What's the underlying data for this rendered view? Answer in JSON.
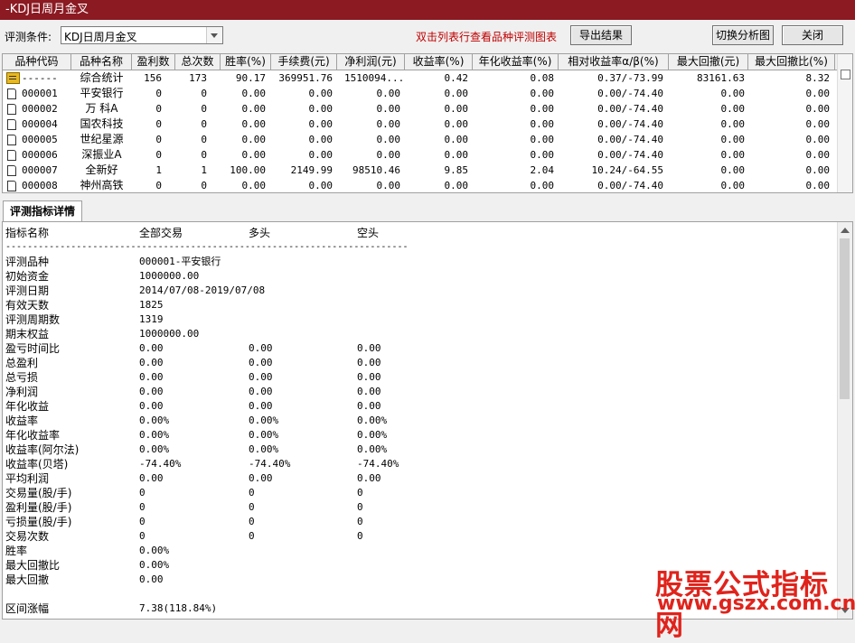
{
  "window": {
    "title": "-KDJ日周月金叉"
  },
  "toolbar": {
    "condition_label": "评测条件:",
    "condition_value": "KDJ日周月金叉",
    "hint": "双击列表行查看品种评测图表",
    "export_label": "导出结果",
    "switch_label": "切换分析图",
    "close_label": "关闭"
  },
  "table": {
    "columns": [
      "品种代码",
      "品种名称",
      "盈利数",
      "总次数",
      "胜率(%)",
      "手续费(元)",
      "净利润(元)",
      "收益率(%)",
      "年化收益率(%)",
      "相对收益率α/β(%)",
      "最大回撤(元)",
      "最大回撤比(%)"
    ],
    "summary": {
      "code": "------",
      "name": "综合统计",
      "wins": "156",
      "total": "173",
      "win_rate": "90.17",
      "fee": "369951.76",
      "net": "1510094...",
      "ret": "0.42",
      "annual": "0.08",
      "rel": "0.37/-73.99",
      "dd": "83161.63",
      "dd_ratio": "8.32"
    },
    "rows": [
      {
        "code": "000001",
        "name": "平安银行",
        "wins": "0",
        "total": "0",
        "win_rate": "0.00",
        "fee": "0.00",
        "net": "0.00",
        "ret": "0.00",
        "annual": "0.00",
        "rel": "0.00/-74.40",
        "dd": "0.00",
        "dd_ratio": "0.00"
      },
      {
        "code": "000002",
        "name": "万 科A",
        "wins": "0",
        "total": "0",
        "win_rate": "0.00",
        "fee": "0.00",
        "net": "0.00",
        "ret": "0.00",
        "annual": "0.00",
        "rel": "0.00/-74.40",
        "dd": "0.00",
        "dd_ratio": "0.00"
      },
      {
        "code": "000004",
        "name": "国农科技",
        "wins": "0",
        "total": "0",
        "win_rate": "0.00",
        "fee": "0.00",
        "net": "0.00",
        "ret": "0.00",
        "annual": "0.00",
        "rel": "0.00/-74.40",
        "dd": "0.00",
        "dd_ratio": "0.00"
      },
      {
        "code": "000005",
        "name": "世纪星源",
        "wins": "0",
        "total": "0",
        "win_rate": "0.00",
        "fee": "0.00",
        "net": "0.00",
        "ret": "0.00",
        "annual": "0.00",
        "rel": "0.00/-74.40",
        "dd": "0.00",
        "dd_ratio": "0.00"
      },
      {
        "code": "000006",
        "name": "深振业A",
        "wins": "0",
        "total": "0",
        "win_rate": "0.00",
        "fee": "0.00",
        "net": "0.00",
        "ret": "0.00",
        "annual": "0.00",
        "rel": "0.00/-74.40",
        "dd": "0.00",
        "dd_ratio": "0.00"
      },
      {
        "code": "000007",
        "name": "全新好",
        "wins": "1",
        "total": "1",
        "win_rate": "100.00",
        "fee": "2149.99",
        "net": "98510.46",
        "ret": "9.85",
        "annual": "2.04",
        "rel": "10.24/-64.55",
        "dd": "0.00",
        "dd_ratio": "0.00"
      },
      {
        "code": "000008",
        "name": "神州高铁",
        "wins": "0",
        "total": "0",
        "win_rate": "0.00",
        "fee": "0.00",
        "net": "0.00",
        "ret": "0.00",
        "annual": "0.00",
        "rel": "0.00/-74.40",
        "dd": "0.00",
        "dd_ratio": "0.00"
      }
    ]
  },
  "detail": {
    "tab_label": "评测指标详情",
    "headers": {
      "name": "指标名称",
      "all": "全部交易",
      "long": "多头",
      "short": "空头"
    },
    "separator": "--------------------------------------------------------------------------",
    "lines": [
      {
        "label": "评测品种",
        "all": "000001-平安银行",
        "long": "",
        "short": ""
      },
      {
        "label": "初始资金",
        "all": "1000000.00",
        "long": "",
        "short": ""
      },
      {
        "label": "评测日期",
        "all": "2014/07/08-2019/07/08",
        "long": "",
        "short": ""
      },
      {
        "label": "有效天数",
        "all": "1825",
        "long": "",
        "short": ""
      },
      {
        "label": "评测周期数",
        "all": "1319",
        "long": "",
        "short": ""
      },
      {
        "label": "期末权益",
        "all": "1000000.00",
        "long": "",
        "short": ""
      },
      {
        "label": "盈亏时间比",
        "all": "0.00",
        "long": "0.00",
        "short": "0.00"
      },
      {
        "label": "总盈利",
        "all": "0.00",
        "long": "0.00",
        "short": "0.00"
      },
      {
        "label": "总亏损",
        "all": "0.00",
        "long": "0.00",
        "short": "0.00"
      },
      {
        "label": "净利润",
        "all": "0.00",
        "long": "0.00",
        "short": "0.00"
      },
      {
        "label": "年化收益",
        "all": "0.00",
        "long": "0.00",
        "short": "0.00"
      },
      {
        "label": "收益率",
        "all": "0.00%",
        "long": "0.00%",
        "short": "0.00%"
      },
      {
        "label": "年化收益率",
        "all": "0.00%",
        "long": "0.00%",
        "short": "0.00%"
      },
      {
        "label": "收益率(阿尔法)",
        "all": "0.00%",
        "long": "0.00%",
        "short": "0.00%"
      },
      {
        "label": "收益率(贝塔)",
        "all": "-74.40%",
        "long": "-74.40%",
        "short": "-74.40%"
      },
      {
        "label": "平均利润",
        "all": "0.00",
        "long": "0.00",
        "short": "0.00"
      },
      {
        "label": "交易量(股/手)",
        "all": "0",
        "long": "0",
        "short": "0"
      },
      {
        "label": "盈利量(股/手)",
        "all": "0",
        "long": "0",
        "short": "0"
      },
      {
        "label": "亏损量(股/手)",
        "all": "0",
        "long": "0",
        "short": "0"
      },
      {
        "label": "交易次数",
        "all": "0",
        "long": "0",
        "short": "0"
      },
      {
        "label": "胜率",
        "all": "0.00%",
        "long": "",
        "short": ""
      },
      {
        "label": "最大回撤比",
        "all": "0.00%",
        "long": "",
        "short": ""
      },
      {
        "label": "最大回撤",
        "all": "0.00",
        "long": "",
        "short": ""
      },
      {
        "label": "",
        "all": "",
        "long": "",
        "short": ""
      },
      {
        "label": "区间涨幅",
        "all": "7.38(118.84%)",
        "long": "",
        "short": ""
      }
    ]
  },
  "watermark": {
    "line1": "股票公式指标网",
    "line2": "www.gszx.com.cn"
  }
}
